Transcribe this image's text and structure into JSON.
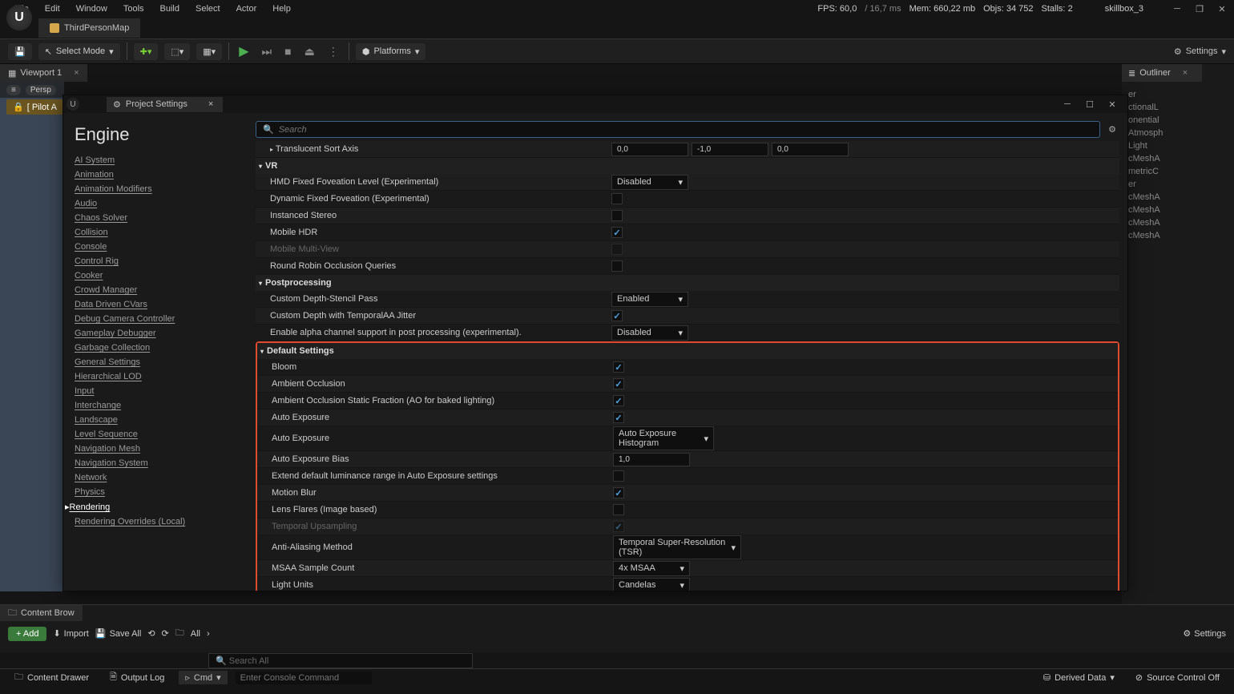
{
  "menuBar": [
    "File",
    "Edit",
    "Window",
    "Tools",
    "Build",
    "Select",
    "Actor",
    "Help"
  ],
  "stats": {
    "fps_label": "FPS:",
    "fps": "60,0",
    "ms": "/ 16,7 ms",
    "mem_label": "Mem:",
    "mem": "660,22 mb",
    "objs_label": "Objs:",
    "objs": "34 752",
    "stalls_label": "Stalls:",
    "stalls": "2"
  },
  "user": "skillbox_3",
  "mapTab": "ThirdPersonMap",
  "toolbar": {
    "selectMode": "Select Mode",
    "platforms": "Platforms",
    "settings": "Settings"
  },
  "viewportTab": "Viewport 1",
  "perspective": "Persp",
  "pilot": "[ Pilot A",
  "outlinerTab": "Outliner",
  "outlinerItems": [
    "er",
    "ctionalL",
    "onential",
    "Atmosph",
    "Light",
    "cMeshA",
    "metricC",
    "er",
    "cMeshA",
    "cMeshA",
    "cMeshA",
    "cMeshA"
  ],
  "modal": {
    "title": "Project Settings",
    "sidebarHeading": "Engine",
    "sidebarItems": [
      "AI System",
      "Animation",
      "Animation Modifiers",
      "Audio",
      "Chaos Solver",
      "Collision",
      "Console",
      "Control Rig",
      "Cooker",
      "Crowd Manager",
      "Data Driven CVars",
      "Debug Camera Controller",
      "Gameplay Debugger",
      "Garbage Collection",
      "General Settings",
      "Hierarchical LOD",
      "Input",
      "Interchange",
      "Landscape",
      "Level Sequence",
      "Navigation Mesh",
      "Navigation System",
      "Network",
      "Physics",
      "Rendering",
      "Rendering Overrides (Local)"
    ],
    "searchPlaceholder": "Search",
    "rows": {
      "translucent": "Translucent Sort Axis",
      "translucent_vals": [
        "0,0",
        "-1,0",
        "0,0"
      ],
      "vr_header": "VR",
      "vr_hmd": "HMD Fixed Foveation Level (Experimental)",
      "vr_hmd_val": "Disabled",
      "vr_dynamic": "Dynamic Fixed Foveation (Experimental)",
      "vr_instanced": "Instanced Stereo",
      "vr_mobilehdr": "Mobile HDR",
      "vr_multiview": "Mobile Multi-View",
      "vr_robin": "Round Robin Occlusion Queries",
      "pp_header": "Postprocessing",
      "pp_stencil": "Custom Depth-Stencil Pass",
      "pp_stencil_val": "Enabled",
      "pp_jitter": "Custom Depth with TemporalAA Jitter",
      "pp_alpha": "Enable alpha channel support in post processing (experimental).",
      "pp_alpha_val": "Disabled",
      "ds_header": "Default Settings",
      "ds_bloom": "Bloom",
      "ds_ao": "Ambient Occlusion",
      "ds_aostatic": "Ambient Occlusion Static Fraction (AO for baked lighting)",
      "ds_autoexp": "Auto Exposure",
      "ds_autoexp2": "Auto Exposure",
      "ds_autoexp2_val": "Auto Exposure Histogram",
      "ds_bias": "Auto Exposure Bias",
      "ds_bias_val": "1,0",
      "ds_extend": "Extend default luminance range in Auto Exposure settings",
      "ds_motion": "Motion Blur",
      "ds_lens": "Lens Flares (Image based)",
      "ds_temporal": "Temporal Upsampling",
      "ds_aa": "Anti-Aliasing Method",
      "ds_aa_val": "Temporal Super-Resolution (TSR)",
      "ds_msaa": "MSAA Sample Count",
      "ds_msaa_val": "4x MSAA",
      "ds_light": "Light Units",
      "ds_light_val": "Candelas"
    }
  },
  "contentBrowser": {
    "tab": "Content Brow",
    "add": "Add",
    "import": "Import",
    "saveAll": "Save All",
    "all": "All",
    "settings": "Settings"
  },
  "searchAll": "Search All",
  "bottomBar": {
    "drawer": "Content Drawer",
    "output": "Output Log",
    "cmd": "Cmd",
    "cmdPlaceholder": "Enter Console Command",
    "derived": "Derived Data",
    "source": "Source Control Off"
  }
}
